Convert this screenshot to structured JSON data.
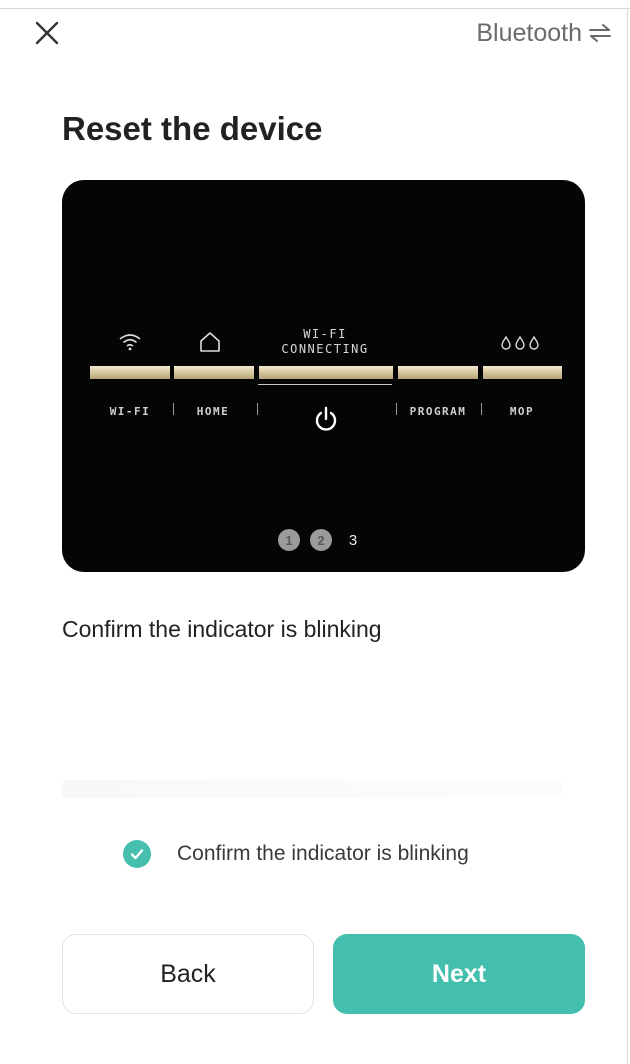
{
  "header": {
    "close_icon": "close-icon",
    "connection_label": "Bluetooth",
    "switch_icon": "swap-arrows-icon"
  },
  "title": "Reset the device",
  "device_panel": {
    "status_line_1": "WI-FI",
    "status_line_2": "CONNECTING",
    "segments": [
      {
        "label": "WI-FI",
        "icon": "wifi-icon"
      },
      {
        "label": "HOME",
        "icon": "home-icon"
      },
      {
        "label": "",
        "icon": "power-icon"
      },
      {
        "label": "PROGRAM",
        "icon": ""
      },
      {
        "label": "MOP",
        "icon": "water-drops-icon"
      }
    ],
    "steps": [
      "1",
      "2",
      "3"
    ],
    "current_step": 3
  },
  "instruction": "Confirm the indicator is blinking",
  "confirm": {
    "label": "Confirm the indicator is blinking",
    "checked": true,
    "color": "#46bfae"
  },
  "buttons": {
    "back": "Back",
    "next": "Next",
    "next_color": "#45bfad"
  }
}
